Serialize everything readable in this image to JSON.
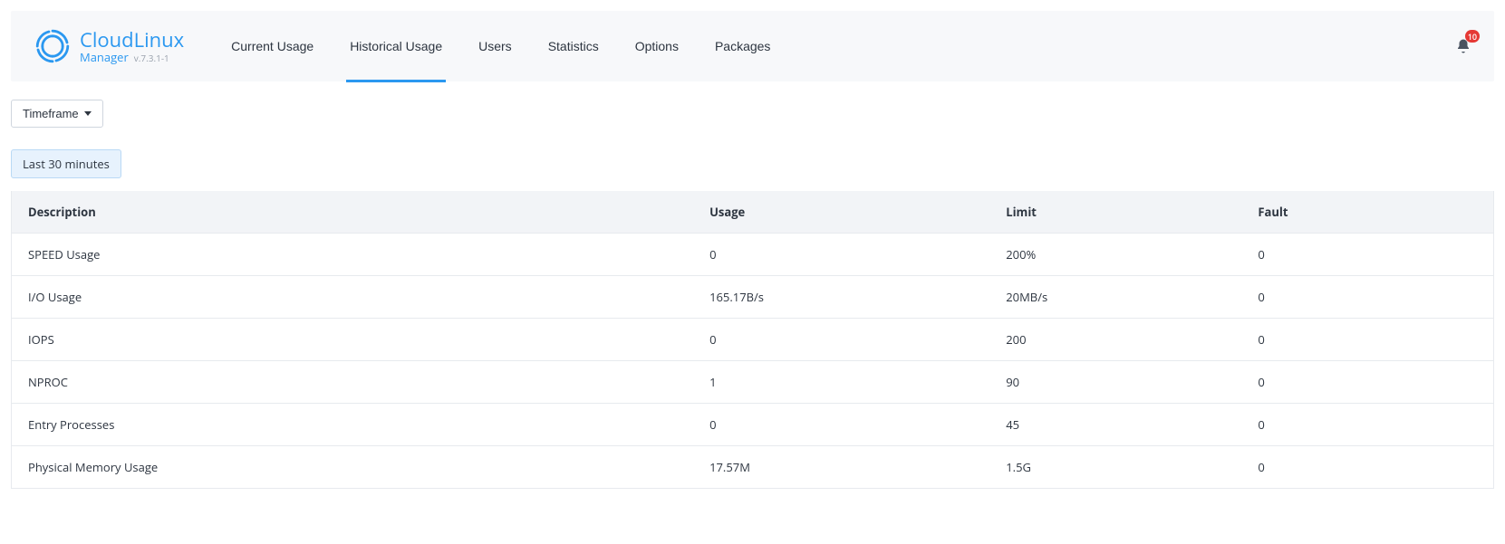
{
  "brand": {
    "title": "CloudLinux",
    "subtitle": "Manager",
    "version": "v.7.3.1-1"
  },
  "tabs": [
    {
      "label": "Current Usage",
      "active": false
    },
    {
      "label": "Historical Usage",
      "active": true
    },
    {
      "label": "Users",
      "active": false
    },
    {
      "label": "Statistics",
      "active": false
    },
    {
      "label": "Options",
      "active": false
    },
    {
      "label": "Packages",
      "active": false
    }
  ],
  "notifications": {
    "count": "10"
  },
  "timeframe": {
    "button_label": "Timeframe",
    "selected_chip": "Last 30 minutes"
  },
  "table": {
    "columns": {
      "description": "Description",
      "usage": "Usage",
      "limit": "Limit",
      "fault": "Fault"
    },
    "rows": [
      {
        "description": "SPEED Usage",
        "usage": "0",
        "limit": "200%",
        "fault": "0"
      },
      {
        "description": "I/O Usage",
        "usage": "165.17B/s",
        "limit": "20MB/s",
        "fault": "0"
      },
      {
        "description": "IOPS",
        "usage": "0",
        "limit": "200",
        "fault": "0"
      },
      {
        "description": "NPROC",
        "usage": "1",
        "limit": "90",
        "fault": "0"
      },
      {
        "description": "Entry Processes",
        "usage": "0",
        "limit": "45",
        "fault": "0"
      },
      {
        "description": "Physical Memory Usage",
        "usage": "17.57M",
        "limit": "1.5G",
        "fault": "0"
      }
    ]
  }
}
